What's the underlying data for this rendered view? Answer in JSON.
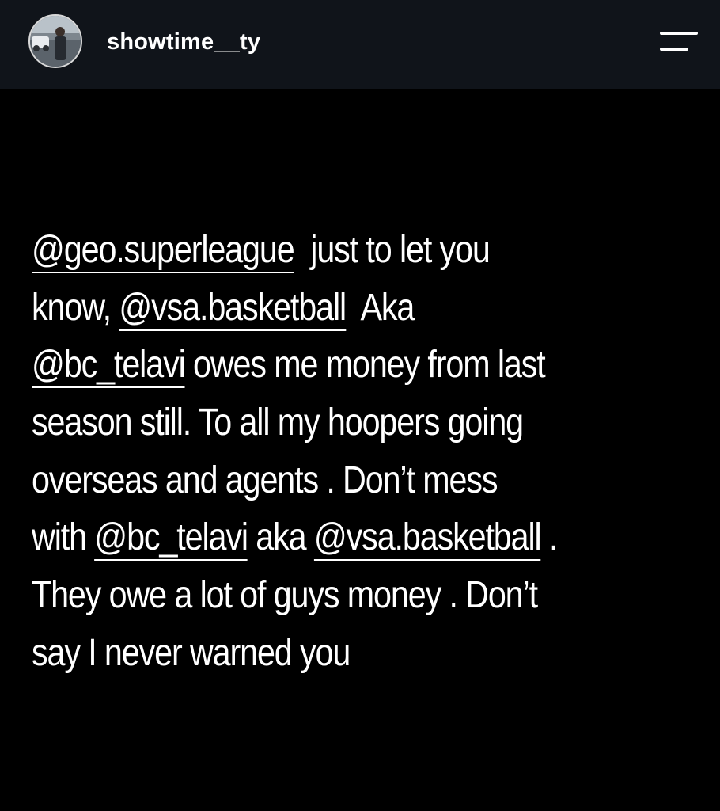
{
  "header": {
    "username": "showtime__ty",
    "avatar_icon": "profile-avatar",
    "menu_icon": "menu-icon"
  },
  "story": {
    "lines": [
      [
        {
          "text": "@geo.superleague",
          "mention": true
        },
        {
          "text": "  just to let you",
          "mention": false
        }
      ],
      [
        {
          "text": "know, ",
          "mention": false
        },
        {
          "text": "@vsa.basketball",
          "mention": true
        },
        {
          "text": "  Aka",
          "mention": false
        }
      ],
      [
        {
          "text": "@bc_telavi",
          "mention": true
        },
        {
          "text": " owes me money from last",
          "mention": false
        }
      ],
      [
        {
          "text": "season still. To all my hoopers going",
          "mention": false
        }
      ],
      [
        {
          "text": "overseas and agents . Don’t mess",
          "mention": false
        }
      ],
      [
        {
          "text": "with ",
          "mention": false
        },
        {
          "text": "@bc_telavi",
          "mention": true
        },
        {
          "text": " aka ",
          "mention": false
        },
        {
          "text": "@vsa.basketball",
          "mention": true
        },
        {
          "text": " .",
          "mention": false
        }
      ],
      [
        {
          "text": "They owe a lot of guys money . Don’t",
          "mention": false
        }
      ],
      [
        {
          "text": "say I never warned you",
          "mention": false
        }
      ]
    ]
  },
  "colors": {
    "header_bg": "#10141a",
    "page_bg": "#000000",
    "text": "#ffffff"
  }
}
